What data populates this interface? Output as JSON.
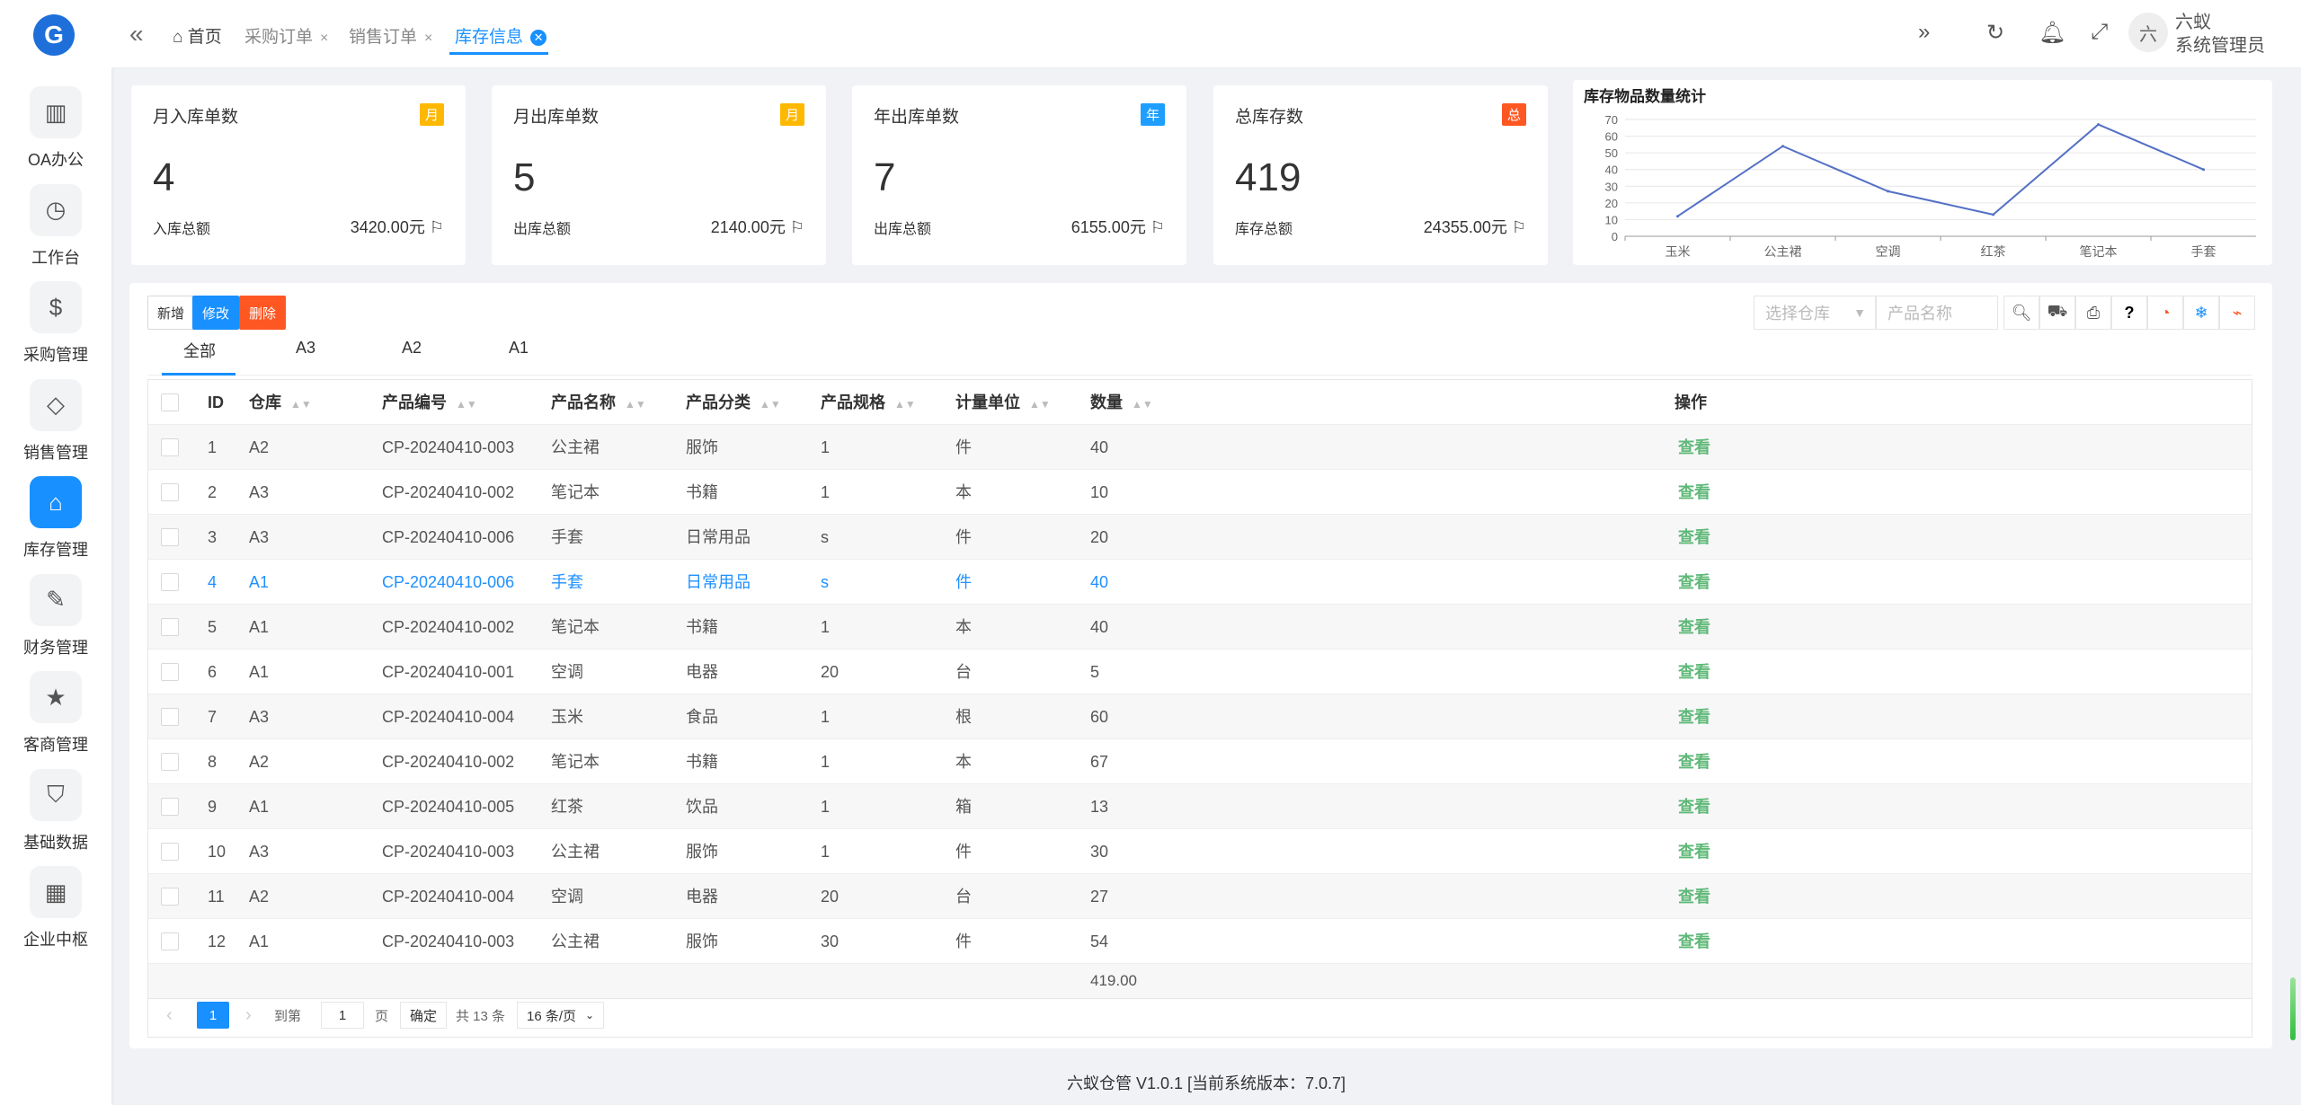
{
  "sidebar": {
    "logo": "G",
    "items": [
      {
        "label": "OA办公",
        "icon": "building-icon"
      },
      {
        "label": "工作台",
        "icon": "dashboard-icon"
      },
      {
        "label": "采购管理",
        "icon": "dollar-icon"
      },
      {
        "label": "销售管理",
        "icon": "diamond-icon"
      },
      {
        "label": "库存管理",
        "icon": "home-icon"
      },
      {
        "label": "财务管理",
        "icon": "question-edit-icon"
      },
      {
        "label": "客商管理",
        "icon": "star-icon"
      },
      {
        "label": "基础数据",
        "icon": "shield-check-icon"
      },
      {
        "label": "企业中枢",
        "icon": "apps-icon"
      }
    ]
  },
  "topbar": {
    "tabs": [
      "首页",
      "采购订单",
      "销售订单",
      "库存信息"
    ],
    "user": {
      "avatar": "六",
      "name": "六蚁",
      "role": "系统管理员"
    }
  },
  "cards": [
    {
      "title": "月入库单数",
      "badge": "月",
      "badge_color": "#ffb800",
      "value": "4",
      "foot_label": "入库总额",
      "foot_value": "3420.00元"
    },
    {
      "title": "月出库单数",
      "badge": "月",
      "badge_color": "#ffb800",
      "value": "5",
      "foot_label": "出库总额",
      "foot_value": "2140.00元"
    },
    {
      "title": "年出库单数",
      "badge": "年",
      "badge_color": "#1e9fff",
      "value": "7",
      "foot_label": "出库总额",
      "foot_value": "6155.00元"
    },
    {
      "title": "总库存数",
      "badge": "总",
      "badge_color": "#ff5722",
      "value": "419",
      "foot_label": "库存总额",
      "foot_value": "24355.00元"
    }
  ],
  "chart_data": {
    "type": "line",
    "title": "库存物品数量统计",
    "categories": [
      "玉米",
      "公主裙",
      "空调",
      "红茶",
      "笔记本",
      "手套"
    ],
    "values": [
      12,
      54,
      27,
      13,
      67,
      40
    ],
    "ylim": [
      0,
      70
    ],
    "yticks": [
      0,
      10,
      20,
      30,
      40,
      50,
      60,
      70
    ],
    "color": "#5470c6",
    "grid": true
  },
  "toolbar": {
    "add": "新增",
    "edit": "修改",
    "delete": "删除",
    "warehouse_placeholder": "选择仓库",
    "product_placeholder": "产品名称"
  },
  "subtabs": [
    "全部",
    "A3",
    "A2",
    "A1"
  ],
  "table": {
    "headers": [
      "ID",
      "仓库",
      "产品编号",
      "产品名称",
      "产品分类",
      "产品规格",
      "计量单位",
      "数量",
      "操作"
    ],
    "action_label": "查看",
    "rows": [
      [
        "1",
        "A2",
        "CP-20240410-003",
        "公主裙",
        "服饰",
        "1",
        "件",
        "40"
      ],
      [
        "2",
        "A3",
        "CP-20240410-002",
        "笔记本",
        "书籍",
        "1",
        "本",
        "10"
      ],
      [
        "3",
        "A3",
        "CP-20240410-006",
        "手套",
        "日常用品",
        "s",
        "件",
        "20"
      ],
      [
        "4",
        "A1",
        "CP-20240410-006",
        "手套",
        "日常用品",
        "s",
        "件",
        "40"
      ],
      [
        "5",
        "A1",
        "CP-20240410-002",
        "笔记本",
        "书籍",
        "1",
        "本",
        "40"
      ],
      [
        "6",
        "A1",
        "CP-20240410-001",
        "空调",
        "电器",
        "20",
        "台",
        "5"
      ],
      [
        "7",
        "A3",
        "CP-20240410-004",
        "玉米",
        "食品",
        "1",
        "根",
        "60"
      ],
      [
        "8",
        "A2",
        "CP-20240410-002",
        "笔记本",
        "书籍",
        "1",
        "本",
        "67"
      ],
      [
        "9",
        "A1",
        "CP-20240410-005",
        "红茶",
        "饮品",
        "1",
        "箱",
        "13"
      ],
      [
        "10",
        "A3",
        "CP-20240410-003",
        "公主裙",
        "服饰",
        "1",
        "件",
        "30"
      ],
      [
        "11",
        "A2",
        "CP-20240410-004",
        "空调",
        "电器",
        "20",
        "台",
        "27"
      ],
      [
        "12",
        "A1",
        "CP-20240410-003",
        "公主裙",
        "服饰",
        "30",
        "件",
        "54"
      ]
    ],
    "total": "419.00"
  },
  "pager": {
    "current": "1",
    "goto_label": "到第",
    "goto_value": "1",
    "page_label": "页",
    "confirm": "确定",
    "total": "共 13 条",
    "per_page": "16 条/页"
  },
  "footer": "六蚁仓管 V1.0.1 [当前系统版本：7.0.7]"
}
